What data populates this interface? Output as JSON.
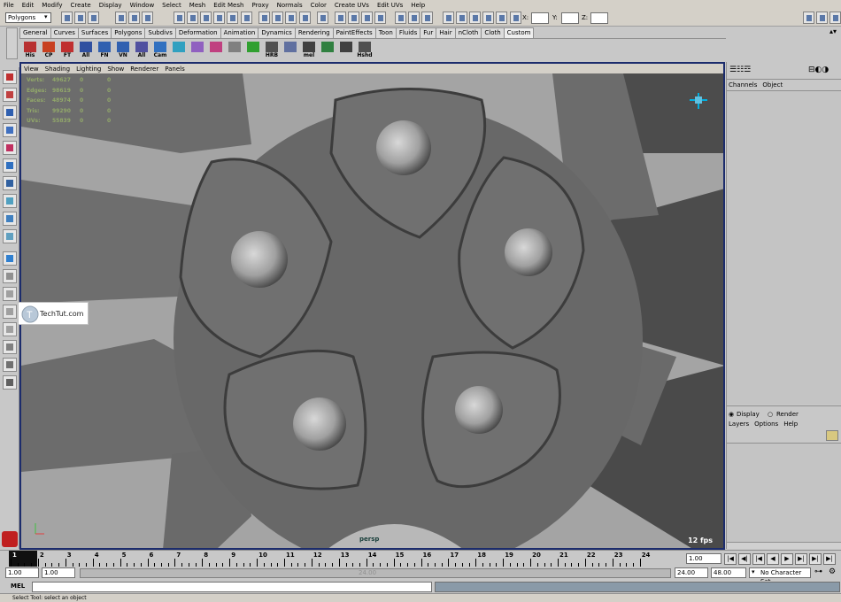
{
  "menubar": [
    "File",
    "Edit",
    "Modify",
    "Create",
    "Display",
    "Window",
    "Select",
    "Mesh",
    "Edit Mesh",
    "Proxy",
    "Normals",
    "Color",
    "Create UVs",
    "Edit UVs",
    "Help"
  ],
  "status": {
    "mode": "Polygons",
    "x_label": "X:",
    "y_label": "Y:",
    "z_label": "Z:"
  },
  "shelf_tabs": [
    "General",
    "Curves",
    "Surfaces",
    "Polygons",
    "Subdivs",
    "Deformation",
    "Animation",
    "Dynamics",
    "Rendering",
    "PaintEffects",
    "Toon",
    "Fluids",
    "Fur",
    "Hair",
    "nCloth",
    "Cloth",
    "Custom"
  ],
  "shelf_active": "Custom",
  "shelf_icons": [
    {
      "label": "His",
      "color": "#b83030"
    },
    {
      "label": "CP",
      "color": "#c84020"
    },
    {
      "label": "FT",
      "color": "#c03030"
    },
    {
      "label": "All",
      "color": "#3050a0"
    },
    {
      "label": "FN",
      "color": "#3060b0"
    },
    {
      "label": "VN",
      "color": "#3060b0"
    },
    {
      "label": "All",
      "color": "#5050a0"
    },
    {
      "label": "Cam",
      "color": "#3070c0"
    },
    {
      "label": "",
      "color": "#30a0c0"
    },
    {
      "label": "",
      "color": "#9060c0"
    },
    {
      "label": "",
      "color": "#c04080"
    },
    {
      "label": "",
      "color": "#808080"
    },
    {
      "label": "",
      "color": "#30a030"
    },
    {
      "label": "HRB",
      "color": "#505050"
    },
    {
      "label": "",
      "color": "#6070a0"
    },
    {
      "label": "mel",
      "color": "#404040"
    },
    {
      "label": "",
      "color": "#308040"
    },
    {
      "label": "",
      "color": "#404040"
    },
    {
      "label": "Hshd",
      "color": "#505050"
    }
  ],
  "viewport": {
    "menu": [
      "View",
      "Shading",
      "Lighting",
      "Show",
      "Renderer",
      "Panels"
    ],
    "hud": [
      {
        "k": "Verts:",
        "v": "49627",
        "a": "0",
        "b": "0"
      },
      {
        "k": "Edges:",
        "v": "98619",
        "a": "0",
        "b": "0"
      },
      {
        "k": "Faces:",
        "v": "48974",
        "a": "0",
        "b": "0"
      },
      {
        "k": "Tris:",
        "v": "99290",
        "a": "0",
        "b": "0"
      },
      {
        "k": "UVs:",
        "v": "55839",
        "a": "0",
        "b": "0"
      }
    ],
    "camera": "persp",
    "fps": "12 fps"
  },
  "channels": {
    "tabs": [
      "Channels",
      "Object"
    ]
  },
  "layers": {
    "display": "Display",
    "render": "Render",
    "menu": [
      "Layers",
      "Options",
      "Help"
    ]
  },
  "watermark": "TechTut.com",
  "timeline": {
    "labels": [
      "1",
      "2",
      "3",
      "4",
      "5",
      "6",
      "7",
      "8",
      "9",
      "10",
      "11",
      "12",
      "13",
      "14",
      "15",
      "16",
      "17",
      "18",
      "19",
      "20",
      "21",
      "22",
      "23",
      "24"
    ],
    "current": "1.00"
  },
  "range": {
    "start": "1.00",
    "start2": "1.00",
    "mid": "24.00",
    "end": "24.00",
    "end2": "48.00",
    "charset": "No Character Set"
  },
  "cmd": {
    "label": "MEL"
  },
  "help": "Select Tool: select an object"
}
